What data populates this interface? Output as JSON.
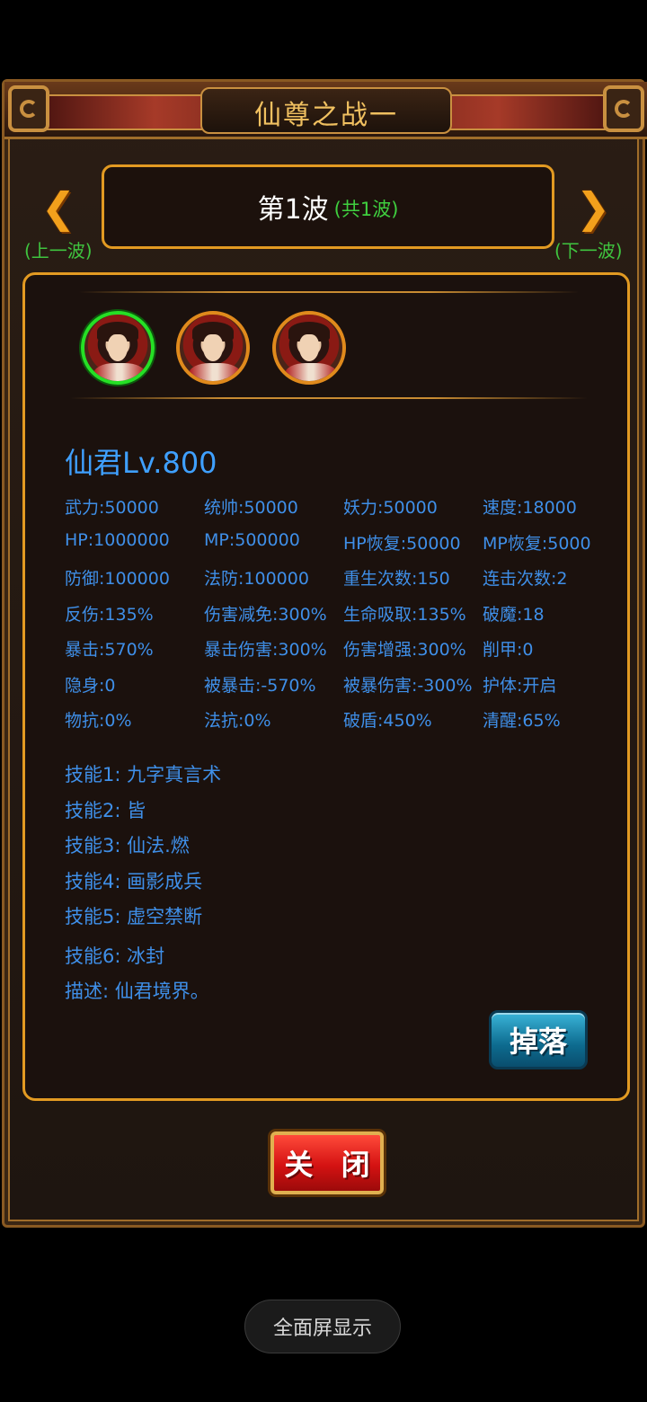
{
  "dialog": {
    "title": "仙尊之战一",
    "wave_main": "第1波",
    "wave_total": "(共1波)",
    "prev_label": "(上一波)",
    "next_label": "(下一波)",
    "prev_icon": "left-arrow",
    "next_icon": "right-arrow"
  },
  "monster": {
    "name": "仙君Lv.800",
    "stats": [
      [
        "武力:50000",
        "统帅:50000",
        "妖力:50000",
        "速度:18000"
      ],
      [
        "HP:1000000",
        "MP:500000",
        "HP恢复:50000",
        "MP恢复:5000"
      ],
      [
        "防御:100000",
        "法防:100000",
        "重生次数:150",
        "连击次数:2"
      ],
      [
        "反伤:135%",
        "伤害减免:300%",
        "生命吸取:135%",
        "破魔:18"
      ],
      [
        "暴击:570%",
        "暴击伤害:300%",
        "伤害增强:300%",
        "削甲:0"
      ],
      [
        "隐身:0",
        "被暴击:-570%",
        "被暴伤害:-300%",
        "护体:开启"
      ],
      [
        "物抗:0%",
        "法抗:0%",
        "破盾:450%",
        "清醒:65%"
      ]
    ],
    "skills": [
      "技能1: 九字真言术",
      "技能2: 皆",
      "技能3: 仙法.燃",
      "技能4: 画影成兵",
      "技能5: 虚空禁断",
      "技能6: 冰封",
      "描述: 仙君境界。"
    ]
  },
  "buttons": {
    "drop": "掉落",
    "close": "关 闭"
  },
  "system": {
    "fullscreen": "全面屏显示"
  },
  "colors": {
    "accent_gold": "#e29a22",
    "stat_blue": "#3f8fe8",
    "green": "#3fc43f"
  }
}
